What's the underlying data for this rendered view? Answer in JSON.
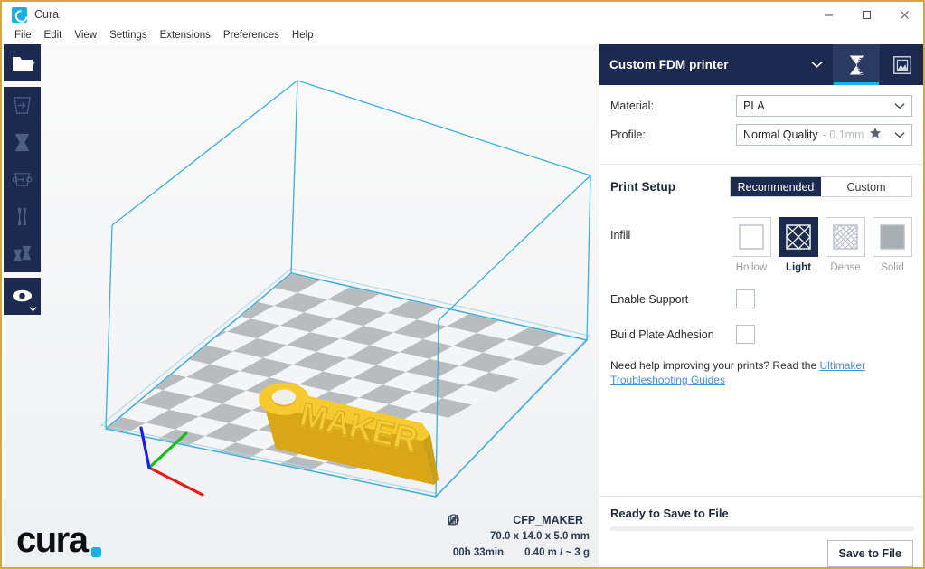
{
  "window": {
    "title": "Cura",
    "logo_icon": "cura-logo-icon",
    "minimize_label": "—",
    "maximize_label": "☐",
    "close_label": "✕"
  },
  "menubar": {
    "items": [
      {
        "label": "File"
      },
      {
        "label": "Edit"
      },
      {
        "label": "View"
      },
      {
        "label": "Settings"
      },
      {
        "label": "Extensions"
      },
      {
        "label": "Preferences"
      },
      {
        "label": "Help"
      }
    ]
  },
  "left_toolbar": {
    "items": [
      {
        "name": "open-file-button",
        "icon": "folder-open-icon"
      },
      {
        "name": "move-tool-button",
        "icon": "move-tool-icon"
      },
      {
        "name": "scale-tool-button",
        "icon": "scale-tool-icon"
      },
      {
        "name": "rotate-tool-button",
        "icon": "rotate-tool-icon"
      },
      {
        "name": "mirror-tool-button",
        "icon": "mirror-tool-icon"
      },
      {
        "name": "per-model-settings-button",
        "icon": "per-model-settings-icon"
      },
      {
        "name": "view-mode-button",
        "icon": "eye-icon"
      }
    ]
  },
  "viewport": {
    "model": {
      "name": "CFP_MAKER",
      "text_on_model": "MAKER",
      "color": "#f2c12e",
      "edit_icon": "pencil-icon"
    },
    "dimensions": "70.0 x 14.0 x 5.0 mm",
    "print_time": "00h 33min",
    "material_usage": "0.40 m / ~ 3 g",
    "time_icon": "clock-icon",
    "material_icon": "filament-icon",
    "buildplate_color_light": "#f3f4f5",
    "buildplate_color_dark": "#b9bcbe",
    "volume_wire_color": "#3bb0d8",
    "axis_x_color": "#e51d1d",
    "axis_y_color": "#17c017",
    "axis_z_color": "#1d1de5",
    "watermark": "cura"
  },
  "right_panel": {
    "printer": {
      "name": "Custom FDM printer",
      "caret_icon": "chevron-down-icon",
      "tabs": [
        {
          "name": "prepare-tab",
          "icon": "slice-preview-icon",
          "active": true
        },
        {
          "name": "monitor-tab",
          "icon": "printer-monitor-icon",
          "active": false
        }
      ]
    },
    "material": {
      "label": "Material:",
      "value": "PLA",
      "caret_icon": "chevron-down-icon"
    },
    "profile": {
      "label": "Profile:",
      "value": "Normal Quality",
      "value_suffix": "- 0.1mm",
      "star_icon": "star-icon",
      "caret_icon": "chevron-down-icon"
    },
    "print_setup": {
      "title": "Print Setup",
      "modes": [
        {
          "label": "Recommended",
          "active": true
        },
        {
          "label": "Custom",
          "active": false
        }
      ]
    },
    "infill": {
      "label": "Infill",
      "options": [
        {
          "label": "Hollow",
          "pattern": "hollow",
          "selected": false
        },
        {
          "label": "Light",
          "pattern": "light",
          "selected": true
        },
        {
          "label": "Dense",
          "pattern": "dense",
          "selected": false
        },
        {
          "label": "Solid",
          "pattern": "solid",
          "selected": false
        }
      ]
    },
    "toggles": [
      {
        "name": "enable-support",
        "label": "Enable Support",
        "checked": false
      },
      {
        "name": "build-plate-adhesion",
        "label": "Build Plate Adhesion",
        "checked": false
      }
    ],
    "help": {
      "prefix": "Need help improving your prints? Read the ",
      "link": "Ultimaker Troubleshooting Guides"
    },
    "footer": {
      "status": "Ready to Save to File",
      "progress_percent": 0,
      "save_label": "Save to File"
    }
  },
  "colors": {
    "navy": "#1c2a4f",
    "accent_cyan": "#1ab0e4",
    "link": "#4a8ed4"
  }
}
